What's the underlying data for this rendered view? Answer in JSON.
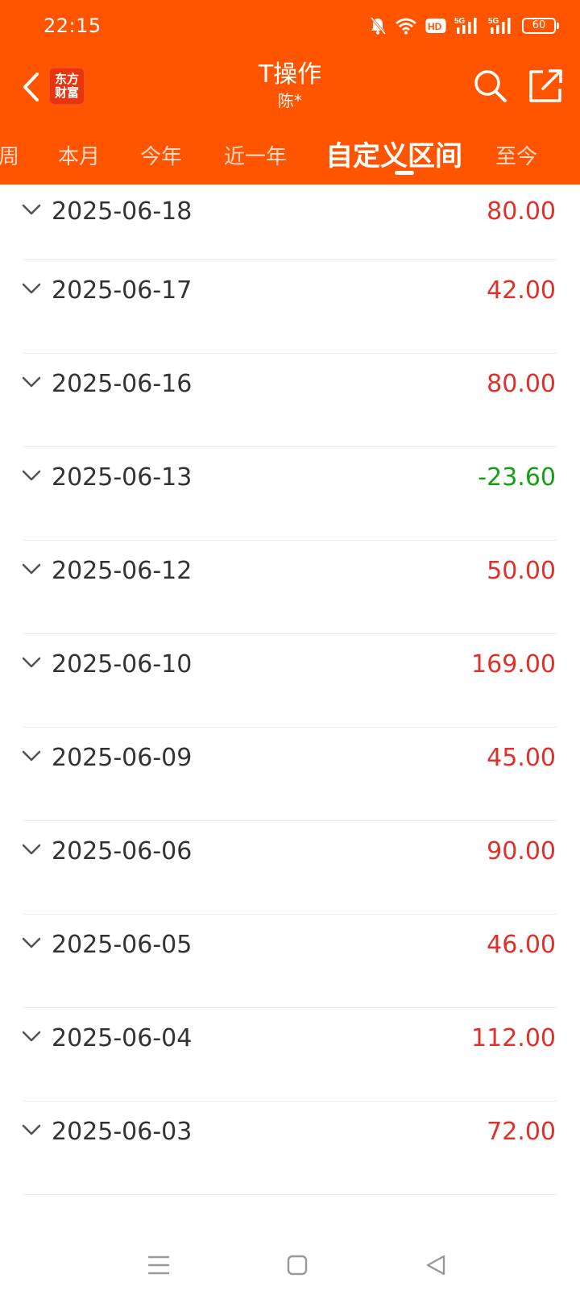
{
  "status": {
    "time": "22:15",
    "battery": "60",
    "hd_label": "HD",
    "net1": "5G",
    "net2": "5G"
  },
  "header": {
    "logo_line1": "东方",
    "logo_line2": "财富",
    "title": "T操作",
    "subtitle": "陈*"
  },
  "tabs": [
    {
      "label": "周",
      "active": false
    },
    {
      "label": "本月",
      "active": false
    },
    {
      "label": "今年",
      "active": false
    },
    {
      "label": "近一年",
      "active": false
    },
    {
      "label": "自定义区间",
      "active": true
    },
    {
      "label": "至今",
      "active": false
    }
  ],
  "colors": {
    "brand": "#ff5500",
    "positive": "#e0302a",
    "negative": "#13a113",
    "text": "#333333"
  },
  "rows": [
    {
      "date": "2025-06-18",
      "amount": "80.00",
      "sign": "positive"
    },
    {
      "date": "2025-06-17",
      "amount": "42.00",
      "sign": "positive"
    },
    {
      "date": "2025-06-16",
      "amount": "80.00",
      "sign": "positive"
    },
    {
      "date": "2025-06-13",
      "amount": "-23.60",
      "sign": "negative"
    },
    {
      "date": "2025-06-12",
      "amount": "50.00",
      "sign": "positive"
    },
    {
      "date": "2025-06-10",
      "amount": "169.00",
      "sign": "positive"
    },
    {
      "date": "2025-06-09",
      "amount": "45.00",
      "sign": "positive"
    },
    {
      "date": "2025-06-06",
      "amount": "90.00",
      "sign": "positive"
    },
    {
      "date": "2025-06-05",
      "amount": "46.00",
      "sign": "positive"
    },
    {
      "date": "2025-06-04",
      "amount": "112.00",
      "sign": "positive"
    },
    {
      "date": "2025-06-03",
      "amount": "72.00",
      "sign": "positive"
    }
  ],
  "icons": {
    "back": "chevron-left-icon",
    "search": "search-icon",
    "share": "share-icon",
    "expand": "chevron-down-icon",
    "nav_menu": "menu-icon",
    "nav_home": "home-icon",
    "nav_back": "back-triangle-icon"
  }
}
